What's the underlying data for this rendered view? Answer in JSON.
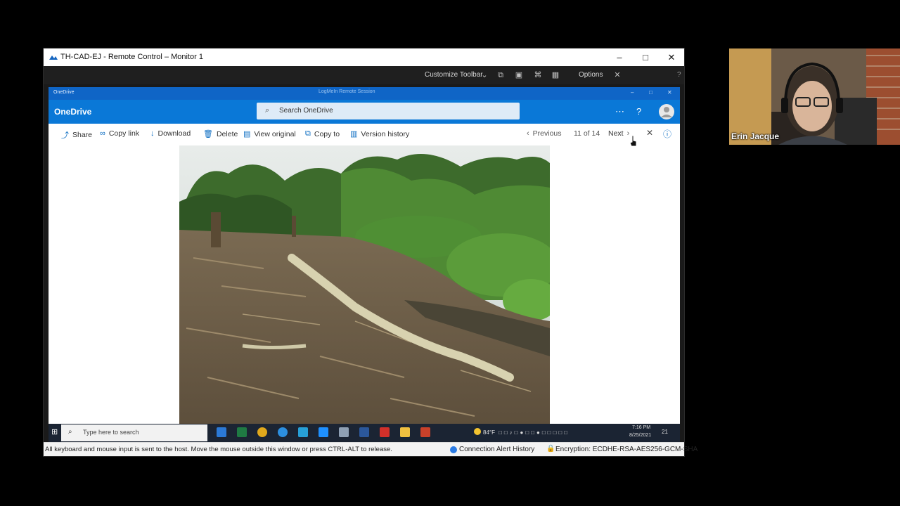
{
  "remote_window": {
    "title": "TH-CAD-EJ - Remote Control – Monitor 1",
    "controls": {
      "minimize": "–",
      "maximize": "□",
      "close": "✕"
    }
  },
  "rc_toolbar": {
    "customize_label": "Customize Toolbar",
    "options_label": "Options",
    "help_label": "?"
  },
  "onedrive": {
    "caption_title": "OneDrive",
    "session_label": "LogMeIn   Remote Session",
    "brand": "OneDrive",
    "search_placeholder": "Search OneDrive",
    "commands": {
      "share": "Share",
      "copy_link": "Copy link",
      "download": "Download",
      "delete": "Delete",
      "view_original": "View original",
      "copy_to": "Copy to",
      "version_history": "Version history"
    },
    "nav": {
      "previous": "Previous",
      "counter": "11 of 14",
      "next": "Next"
    }
  },
  "taskbar": {
    "search_placeholder": "Type here to search",
    "weather": "84°F",
    "time": "7:16 PM",
    "date": "8/25/2021",
    "notifications": "21"
  },
  "status_bar": {
    "message": "All keyboard and mouse input is sent to the host. Move the mouse outside this window or press CTRL-ALT to release.",
    "alert_history": "Connection Alert History",
    "encryption": "Encryption: ECDHE-RSA-AES256-GCM-SHA"
  },
  "webcam": {
    "participant_name": "Erin Jacque"
  },
  "colors": {
    "onedrive_blue": "#0a78d7",
    "taskbar": "#1b2433",
    "toolbar": "#1f1f1f"
  }
}
